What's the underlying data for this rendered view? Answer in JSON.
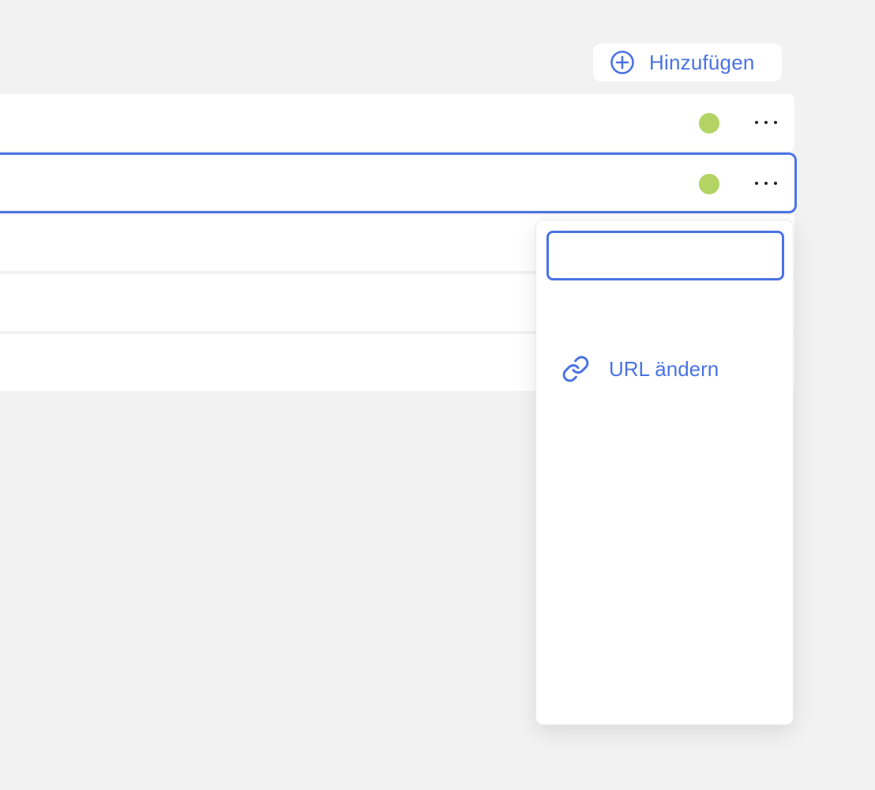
{
  "header": {
    "add_button": {
      "label": "Hinzufügen",
      "icon": "plus-circle-icon"
    }
  },
  "colors": {
    "accent": "#4a73e3",
    "status_online": "#b3d465",
    "background": "#f2f2f2"
  },
  "list": {
    "rows": [
      {
        "status": "online",
        "more_icon": "more-horizontal-icon",
        "selected": false
      },
      {
        "status": "online",
        "more_icon": "more-horizontal-icon",
        "selected": true
      },
      {},
      {},
      {}
    ]
  },
  "dropdown": {
    "input": {
      "value": "",
      "placeholder": ""
    },
    "items": [
      {
        "label": "URL ändern",
        "icon": "link-icon"
      }
    ]
  }
}
